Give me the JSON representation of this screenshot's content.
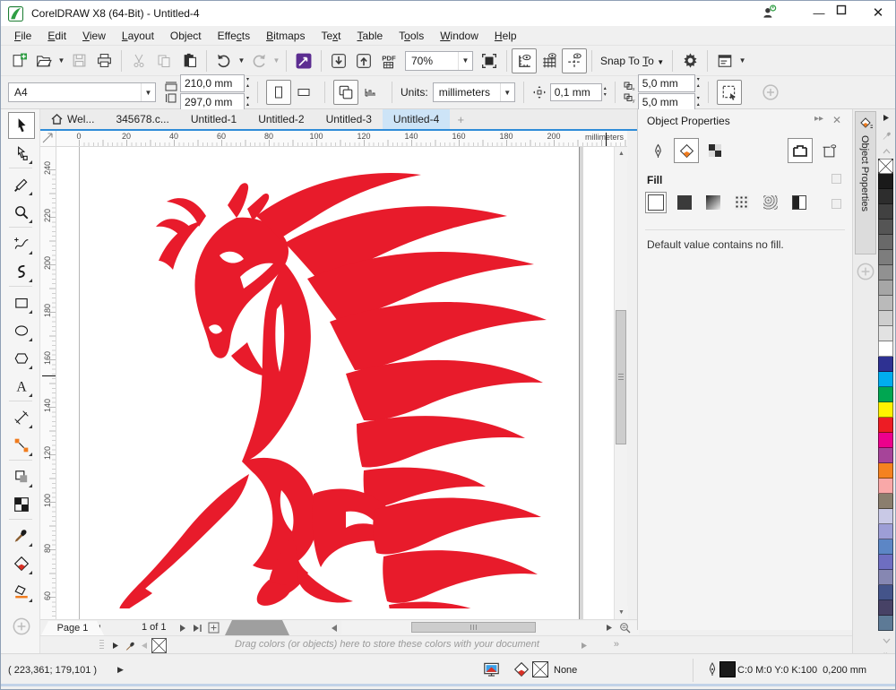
{
  "titlebar": {
    "title": "CorelDRAW X8 (64-Bit) - Untitled-4"
  },
  "menubar": {
    "items": [
      {
        "label": "File",
        "u": 0
      },
      {
        "label": "Edit",
        "u": 0
      },
      {
        "label": "View",
        "u": 0
      },
      {
        "label": "Layout",
        "u": 0
      },
      {
        "label": "Object",
        "u": -1
      },
      {
        "label": "Effects",
        "u": 4
      },
      {
        "label": "Bitmaps",
        "u": 0
      },
      {
        "label": "Text",
        "u": 2
      },
      {
        "label": "Table",
        "u": 0
      },
      {
        "label": "Tools",
        "u": 1
      },
      {
        "label": "Window",
        "u": 0
      },
      {
        "label": "Help",
        "u": 0
      }
    ]
  },
  "toolbar": {
    "zoom_value": "70%",
    "snap_label": "Snap To",
    "icons": [
      "new-document",
      "open",
      "save",
      "print",
      "cut",
      "copy",
      "paste",
      "undo",
      "redo",
      "search-content",
      "import",
      "export",
      "publish-pdf",
      "zoom-level",
      "full-screen-preview",
      "show-rulers",
      "show-grid",
      "show-guidelines",
      "snap-to",
      "options-gear",
      "application-launcher"
    ]
  },
  "propbar": {
    "preset": "A4",
    "width": "210,0 mm",
    "height": "297,0 mm",
    "units_label": "Units:",
    "units_value": "millimeters",
    "nudge": "0,1 mm",
    "dup_x": "5,0 mm",
    "dup_y": "5,0 mm"
  },
  "tabs": {
    "items": [
      {
        "label": "Wel...",
        "home": true
      },
      {
        "label": "345678.c..."
      },
      {
        "label": "Untitled-1"
      },
      {
        "label": "Untitled-2"
      },
      {
        "label": "Untitled-3"
      },
      {
        "label": "Untitled-4",
        "active": true
      }
    ],
    "new_tab": "+"
  },
  "rulers": {
    "h_ticks": [
      "0",
      "20",
      "40",
      "60",
      "80",
      "100",
      "120",
      "140",
      "160",
      "180",
      "200"
    ],
    "v_ticks": [
      "240",
      "220",
      "200",
      "180",
      "160",
      "140",
      "120",
      "100",
      "80",
      "60"
    ],
    "unit_label": "millimeters"
  },
  "toolbox": {
    "tools": [
      {
        "name": "pick-tool",
        "selected": true
      },
      {
        "name": "shape-tool",
        "flyout": true
      },
      {
        "name": "crop-tool",
        "flyout": true
      },
      {
        "name": "zoom-tool",
        "flyout": true
      },
      {
        "name": "freehand-tool",
        "flyout": true
      },
      {
        "name": "artistic-media-tool",
        "flyout": true
      },
      {
        "name": "rectangle-tool",
        "flyout": true
      },
      {
        "name": "ellipse-tool",
        "flyout": true
      },
      {
        "name": "polygon-tool",
        "flyout": true
      },
      {
        "name": "text-tool",
        "flyout": true
      },
      {
        "name": "dimension-tool",
        "flyout": true
      },
      {
        "name": "connector-tool",
        "flyout": true
      },
      {
        "name": "drop-shadow-tool",
        "flyout": true
      },
      {
        "name": "transparency-tool"
      },
      {
        "name": "color-eyedropper-tool",
        "flyout": true
      },
      {
        "name": "interactive-fill-tool",
        "flyout": true
      },
      {
        "name": "smart-fill-tool",
        "flyout": true
      }
    ],
    "separators_after": [
      1,
      3,
      5,
      9,
      11,
      13
    ]
  },
  "canvas": {
    "artwork": {
      "subject": "tribal flame horse clipart, rearing, facing left",
      "color": "#e81b2b"
    }
  },
  "page_nav": {
    "counter": "1 of 1",
    "page_label": "Page 1"
  },
  "doc_palette": {
    "hint": "Drag colors (or objects) here to store these colors with your document"
  },
  "docker": {
    "title": "Object Properties",
    "section_fill": "Fill",
    "message": "Default value contains no fill.",
    "tab_icons": [
      "outline-pen",
      "fill",
      "transparency"
    ],
    "fill_types": [
      "no-fill",
      "uniform-fill",
      "fountain-fill",
      "pattern-fill",
      "texture-fill",
      "postscript-fill"
    ],
    "vertical_tab_label": "Object Properties"
  },
  "palette": {
    "colors": [
      "none",
      "#1a1a1a",
      "#2d2d2d",
      "#414141",
      "#555555",
      "#696969",
      "#7d7d7d",
      "#919191",
      "#a6a6a6",
      "#bababa",
      "#cecece",
      "#e2e2e2",
      "#ffffff",
      "#2e3192",
      "#00adef",
      "#00a651",
      "#fff200",
      "#ed1c24",
      "#ec008c",
      "#a64499",
      "#f58220",
      "#f9a8a8",
      "#8b7e6e",
      "#c9c9e6",
      "#9d9ed6",
      "#5c86c5",
      "#6e6ec1",
      "#8687b2",
      "#44548a",
      "#474266",
      "#5d7a96"
    ]
  },
  "status": {
    "coords": "( 223,361; 179,101 )",
    "fill_none": "None",
    "outline_info": "C:0 M:0 Y:0 K:100  0,200 mm"
  }
}
